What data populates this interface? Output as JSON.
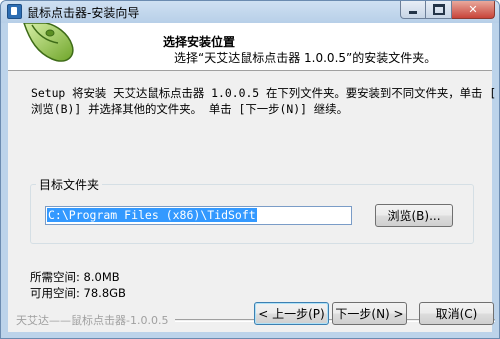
{
  "window": {
    "title": "鼠标点击器-安装向导",
    "icons": {
      "app": "installer-icon",
      "minimize": "minimize-icon",
      "maximize": "maximize-icon",
      "close": "close-icon"
    }
  },
  "header": {
    "title": "选择安装位置",
    "subtitle": "选择“天艾达鼠标点击器 1.0.0.5”的安装文件夹。",
    "icon": "mouse-icon"
  },
  "description": {
    "line1": "Setup 将安装 天艾达鼠标点击器 1.0.0.5 在下列文件夹。要安装到不同文件夹，单击 [",
    "line2": "浏览(B)] 并选择其他的文件夹。 单击 [下一步(N)] 继续。"
  },
  "destination": {
    "group_label": "目标文件夹",
    "path_value": "C:\\Program Files (x86)\\TidSoft",
    "browse_label": "浏览(B)..."
  },
  "space": {
    "required": "所需空间: 8.0MB",
    "available": "可用空间: 78.8GB"
  },
  "footer": {
    "branding": "天艾达——鼠标点击器-1.0.0.5",
    "back_label": "< 上一步(P)",
    "next_label": "下一步(N) >",
    "cancel_label": "取消(C)"
  }
}
